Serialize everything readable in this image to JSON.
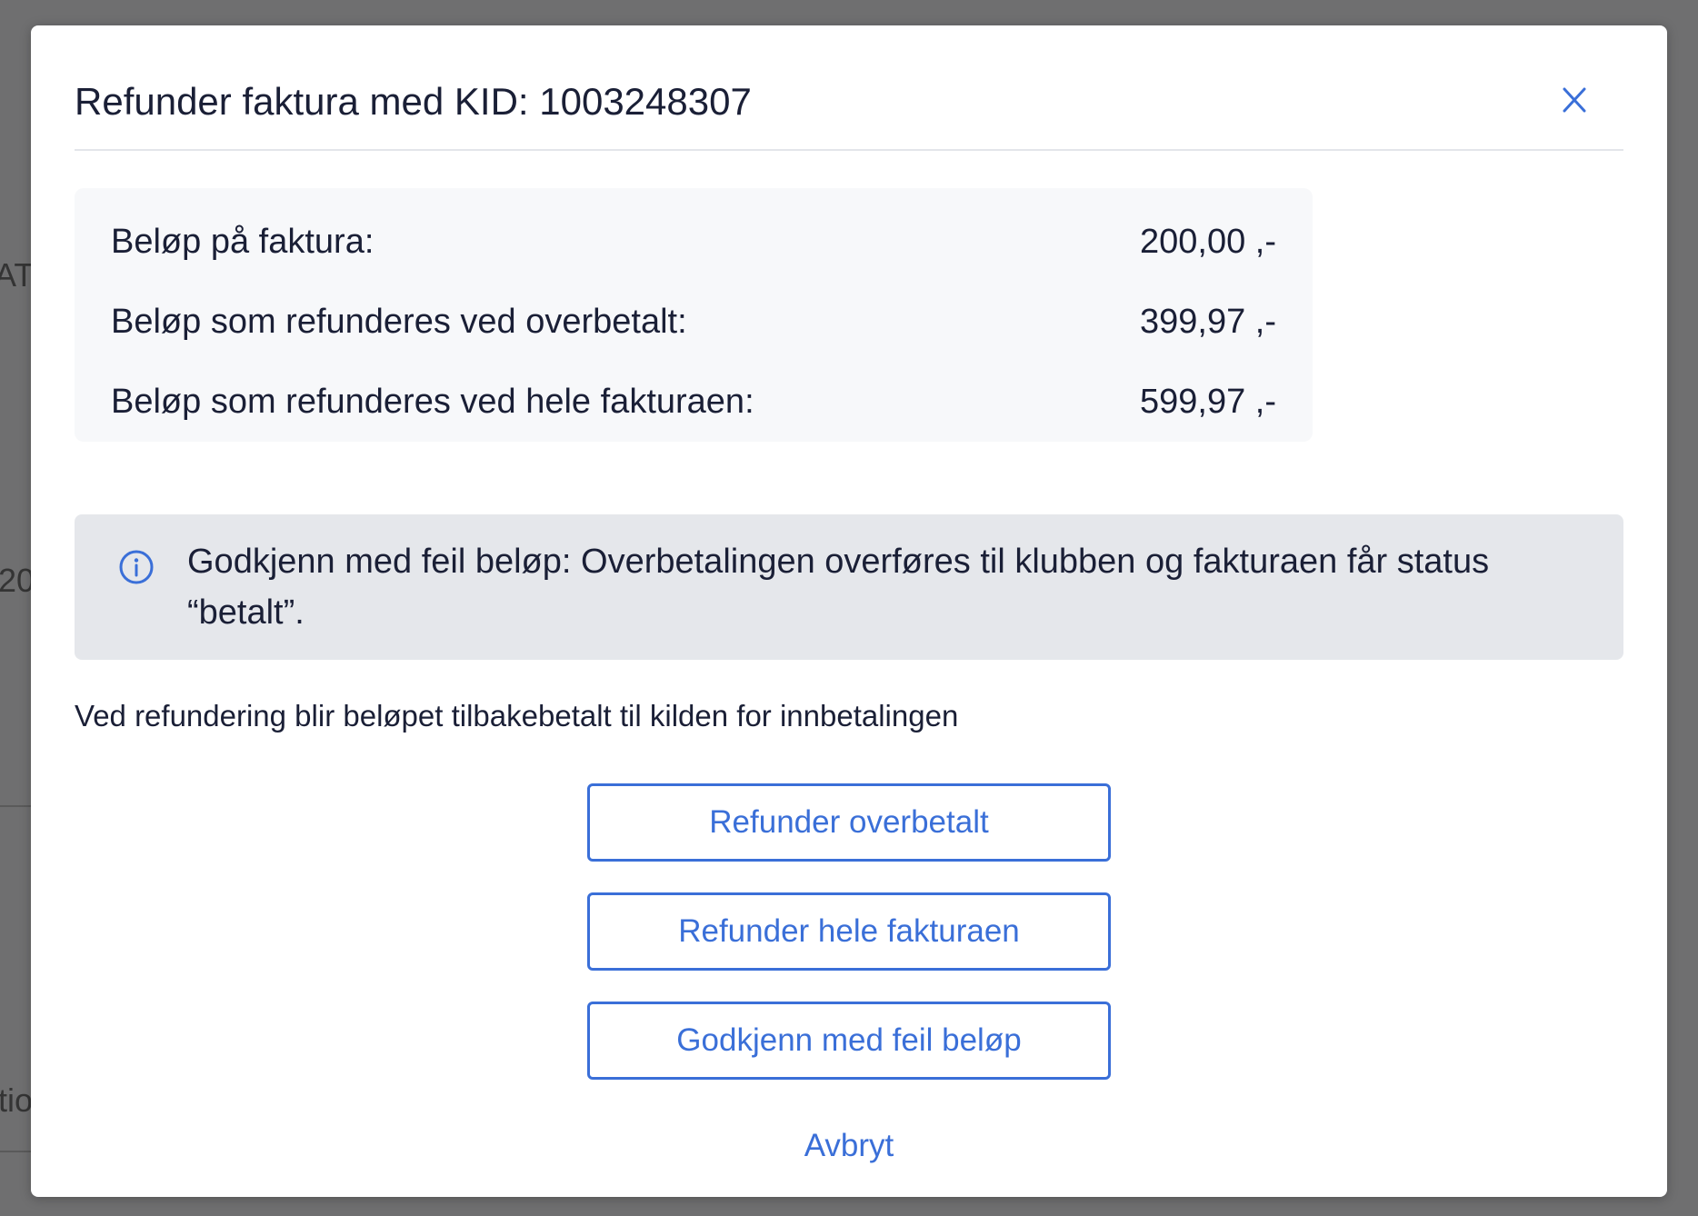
{
  "backdrop": {
    "fragments": [
      "AT",
      "20",
      "tio"
    ]
  },
  "modal": {
    "title": "Refunder faktura med KID: 1003248307",
    "close_label": "X",
    "summary": [
      {
        "label": "Beløp på faktura:",
        "value": "200,00 ,-"
      },
      {
        "label": "Beløp som refunderes ved overbetalt:",
        "value": "399,97 ,-"
      },
      {
        "label": "Beløp som refunderes ved hele fakturaen:",
        "value": "599,97 ,-"
      }
    ],
    "info": {
      "icon": "info-icon",
      "text": "Godkjenn med feil beløp: Overbetalingen overføres til klubben og fakturaen får status “betalt”."
    },
    "refund_note": "Ved refundering blir beløpet tilbakebetalt til kilden for innbetalingen",
    "buttons": {
      "refund_overpaid": "Refunder overbetalt",
      "refund_full": "Refunder hele fakturaen",
      "approve_wrong_amount": "Godkjenn med feil beløp"
    },
    "cancel_label": "Avbryt"
  },
  "colors": {
    "accent": "#3a6fd8",
    "text": "#1a1f36",
    "info_background": "#e5e7eb",
    "summary_background": "#f7f8fa",
    "overlay": "#6f6f70"
  }
}
